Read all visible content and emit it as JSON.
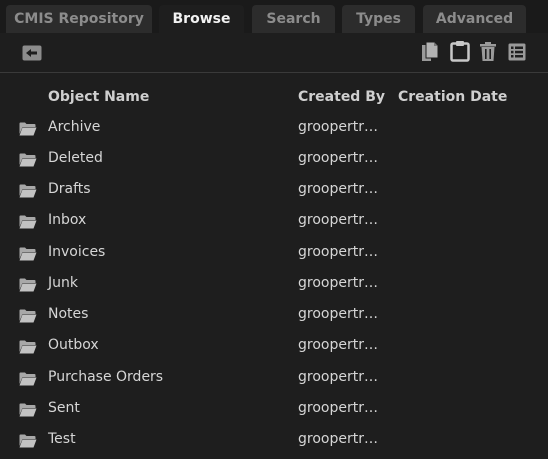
{
  "tabs": [
    {
      "label": "CMIS Repository",
      "active": false
    },
    {
      "label": "Browse",
      "active": true
    },
    {
      "label": "Search",
      "active": false
    },
    {
      "label": "Types",
      "active": false
    },
    {
      "label": "Advanced",
      "active": false
    }
  ],
  "toolbar": {
    "back_icon": "back-arrow-icon",
    "copy_icon": "copy-icon",
    "paste_icon": "clipboard-icon",
    "delete_icon": "trash-icon",
    "properties_icon": "list-icon"
  },
  "columns": {
    "name": "Object Name",
    "created_by": "Created By",
    "creation_date": "Creation Date"
  },
  "rows": [
    {
      "name": "Archive",
      "created_by": "groopertrai…",
      "creation_date": ""
    },
    {
      "name": "Deleted",
      "created_by": "groopertrai…",
      "creation_date": ""
    },
    {
      "name": "Drafts",
      "created_by": "groopertrai…",
      "creation_date": ""
    },
    {
      "name": "Inbox",
      "created_by": "groopertrai…",
      "creation_date": ""
    },
    {
      "name": "Invoices",
      "created_by": "groopertrai…",
      "creation_date": ""
    },
    {
      "name": "Junk",
      "created_by": "groopertrai…",
      "creation_date": ""
    },
    {
      "name": "Notes",
      "created_by": "groopertrai…",
      "creation_date": ""
    },
    {
      "name": "Outbox",
      "created_by": "groopertrai…",
      "creation_date": ""
    },
    {
      "name": "Purchase Orders",
      "created_by": "groopertrai…",
      "creation_date": ""
    },
    {
      "name": "Sent",
      "created_by": "groopertrai…",
      "creation_date": ""
    },
    {
      "name": "Test",
      "created_by": "groopertrai…",
      "creation_date": ""
    }
  ],
  "colors": {
    "background": "#1e1e1e",
    "tab_inactive": "#2c2c2c",
    "tab_active_text": "#f2f2f2",
    "icon": "#9a9a9a"
  }
}
